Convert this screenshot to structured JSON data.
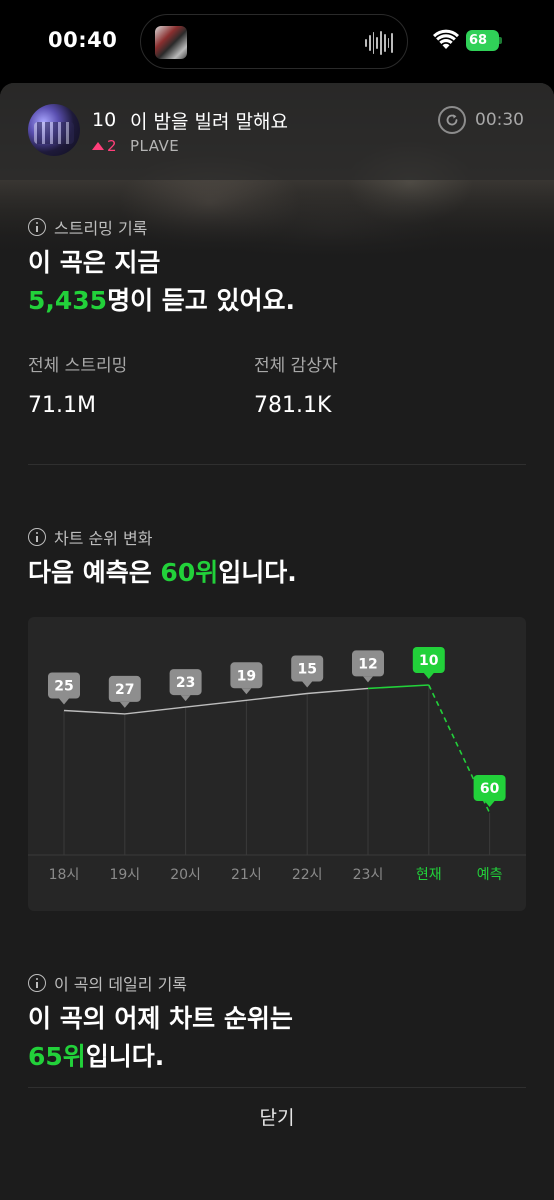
{
  "status_bar": {
    "time": "00:40",
    "battery": "68",
    "icons": [
      "wifi-icon",
      "battery-charging-icon"
    ],
    "battery_color": "#30d158"
  },
  "now_playing": {
    "rank": "10",
    "title": "이 밤을 빌려 말해요",
    "rank_change": "2",
    "rank_change_direction": "up",
    "artist": "PLAVE",
    "duration": "00:30",
    "replay_icon": "replay-icon"
  },
  "streaming": {
    "section_label": "스트리밍 기록",
    "headline_line1": "이 곡은 지금",
    "listeners_now": "5,435",
    "headline_line2_suffix": "명이 듣고 있어요.",
    "total_streams_label": "전체 스트리밍",
    "total_streams_value": "71.1M",
    "total_listeners_label": "전체 감상자",
    "total_listeners_value": "781.1K"
  },
  "rank_change_section": {
    "section_label": "차트 순위 변화",
    "headline_prefix": "다음 예측은 ",
    "predicted_rank": "60위",
    "headline_suffix": "입니다."
  },
  "chart_data": {
    "type": "line",
    "categories": [
      "18시",
      "19시",
      "20시",
      "21시",
      "22시",
      "23시",
      "현재",
      "예측"
    ],
    "series": [
      {
        "values": [
          25,
          27,
          23,
          19,
          15,
          12,
          10,
          60
        ]
      }
    ],
    "data_labels": [
      "25",
      "27",
      "23",
      "19",
      "15",
      "12",
      "10",
      "60"
    ],
    "highlight_categories": [
      "현재",
      "예측"
    ],
    "predicted_segment": {
      "from": "현재",
      "to": "예측",
      "style": "dashed"
    },
    "y_axis": "rank (lower is better, inverted)",
    "colors": {
      "normal": "#8e8e8e",
      "highlight": "#22d13a",
      "line": "#bdbdbd"
    },
    "grid": true,
    "legend": "none"
  },
  "daily_section": {
    "section_label": "이 곡의 데일리 기록",
    "headline_line1": "이 곡의 어제 차트 순위는",
    "yesterday_rank": "65위",
    "headline_line2_suffix": "입니다."
  },
  "footer": {
    "close_label": "닫기"
  },
  "colors": {
    "accent_green": "#22d13a",
    "rank_up": "#ff3f7a",
    "sheet_bg": "#1c1c1c"
  }
}
